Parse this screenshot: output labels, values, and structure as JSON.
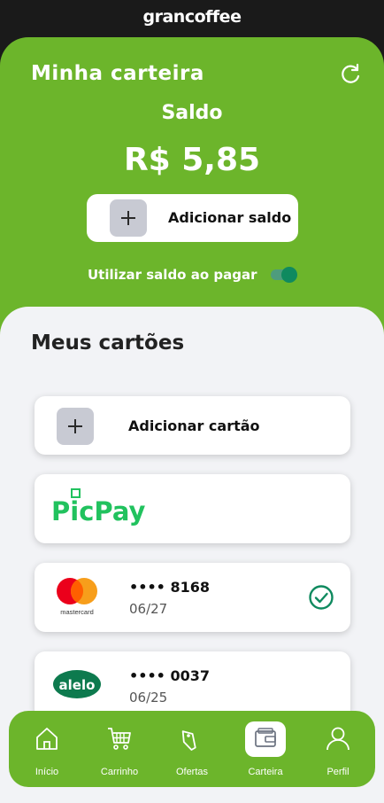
{
  "brand": "grancoffee",
  "header": {
    "title": "Minha carteira",
    "refresh_icon": "refresh-icon"
  },
  "balance": {
    "label": "Saldo",
    "value": "R$ 5,85",
    "add_label": "Adicionar saldo",
    "use_label": "Utilizar saldo ao pagar",
    "use_enabled": true
  },
  "cards_section": {
    "title": "Meus cartões",
    "add_label": "Adicionar cartão",
    "items": [
      {
        "brand": "PicPay",
        "logo_text": "PicPay"
      },
      {
        "brand": "mastercard",
        "logo_text": "mastercard",
        "number": "•••• 8168",
        "expiry": "06/27",
        "selected": true
      },
      {
        "brand": "alelo",
        "logo_text": "alelo",
        "number": "•••• 0037",
        "expiry": "06/25"
      }
    ]
  },
  "nav": {
    "items": [
      {
        "label": "Início",
        "icon": "home-icon"
      },
      {
        "label": "Carrinho",
        "icon": "cart-icon"
      },
      {
        "label": "Ofertas",
        "icon": "tag-icon"
      },
      {
        "label": "Carteira",
        "icon": "wallet-icon",
        "active": true
      },
      {
        "label": "Perfil",
        "icon": "user-icon"
      }
    ]
  },
  "colors": {
    "primary_green": "#6cb52b",
    "toggle_green": "#0f8a5f",
    "picpay_green": "#21c25e",
    "alelo_green": "#0d7a4e",
    "background": "#f2f3f6"
  }
}
